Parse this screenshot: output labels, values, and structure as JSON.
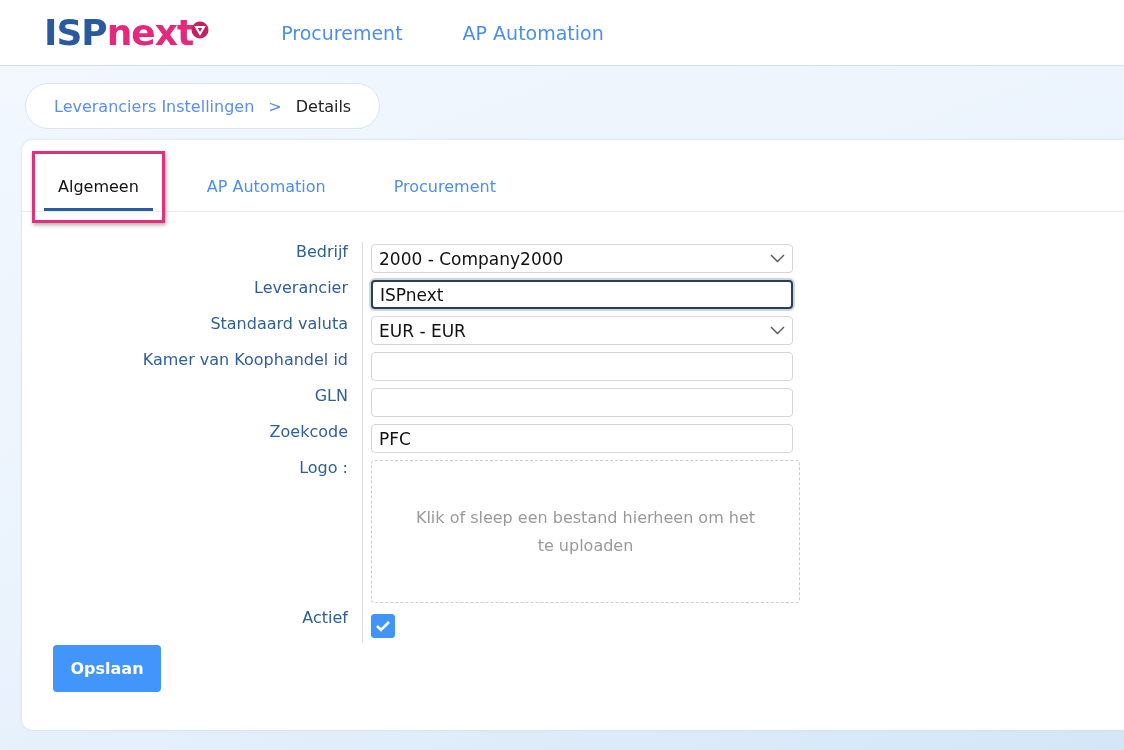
{
  "header": {
    "logo": {
      "part_1": "ISP",
      "part_2": "next"
    },
    "nav": [
      {
        "label": "Procurement"
      },
      {
        "label": "AP Automation"
      }
    ]
  },
  "breadcrumb": {
    "items": [
      "Leveranciers Instellingen"
    ],
    "separator": ">",
    "current": "Details"
  },
  "tabs": [
    {
      "label": "Algemeen",
      "selected": true,
      "highlighted": true
    },
    {
      "label": "AP Automation",
      "selected": false,
      "highlighted": false
    },
    {
      "label": "Procurement",
      "selected": false,
      "highlighted": false
    }
  ],
  "form": [
    {
      "kind": "select",
      "label": "Bedrijf",
      "value": "2000 - Company2000"
    },
    {
      "kind": "text",
      "label": "Leverancier",
      "value": "ISPnext",
      "focused": true
    },
    {
      "kind": "select",
      "label": "Standaard valuta",
      "value": "EUR - EUR"
    },
    {
      "kind": "text",
      "label": "Kamer van Koophandel id",
      "focused": false
    },
    {
      "kind": "text",
      "label": "GLN",
      "focused": false
    },
    {
      "kind": "text",
      "label": "Zoekcode",
      "value": "PFC",
      "focused": false
    },
    {
      "kind": "upload",
      "label": "Logo :",
      "placeholder": "Klik of sleep een bestand hierheen om het te uploaden"
    },
    {
      "kind": "checkbox",
      "label": "Actief",
      "checked": true
    }
  ],
  "buttons": [
    {
      "label": "Opslaan"
    }
  ]
}
